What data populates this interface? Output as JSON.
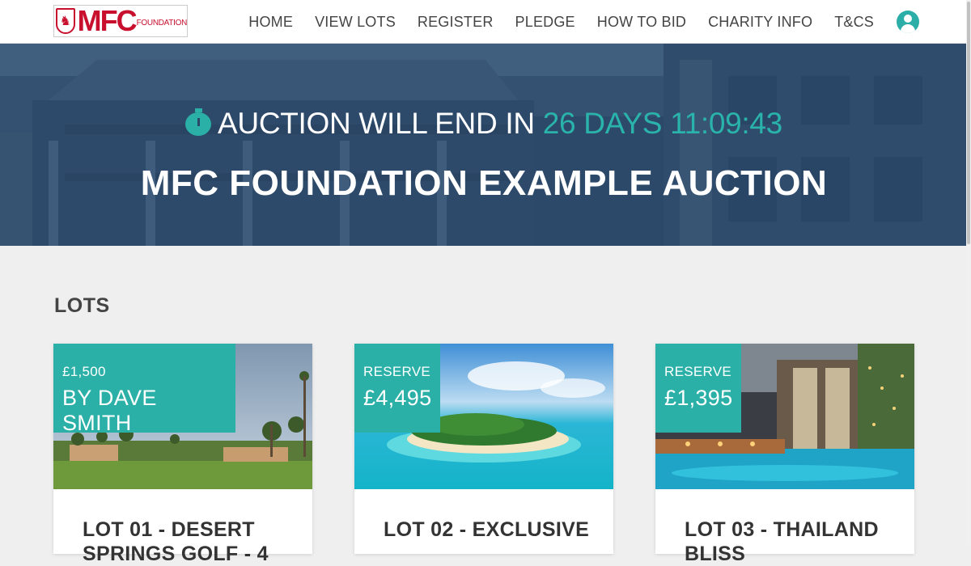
{
  "brand": {
    "logo_text": "MFC",
    "logo_sub": "FOUNDATION",
    "brand_color": "#c8102e"
  },
  "nav": {
    "items": [
      "HOME",
      "VIEW LOTS",
      "REGISTER",
      "PLEDGE",
      "HOW TO BID",
      "CHARITY INFO",
      "T&CS"
    ],
    "user_icon": "user-circle-icon"
  },
  "hero": {
    "timer_prefix": "AUCTION WILL END IN",
    "countdown": "26 DAYS 11:09:43",
    "title": "MFC FOUNDATION EXAMPLE AUCTION",
    "timer_icon": "stopwatch-icon"
  },
  "section": {
    "lots_heading": "LOTS"
  },
  "lots": [
    {
      "badge_small": "£1,500",
      "badge_big": "BY DAVE SMITH",
      "title": "LOT 01 - DESERT SPRINGS GOLF - 4"
    },
    {
      "badge_small": "RESERVE",
      "badge_big": "£4,495",
      "title": "LOT 02 - EXCLUSIVE"
    },
    {
      "badge_small": "RESERVE",
      "badge_big": "£1,395",
      "title": "LOT 03 - THAILAND BLISS"
    }
  ],
  "colors": {
    "accent": "#2bb0a8",
    "hero_overlay": "#2b4868",
    "countdown": "#2ab3ab"
  }
}
